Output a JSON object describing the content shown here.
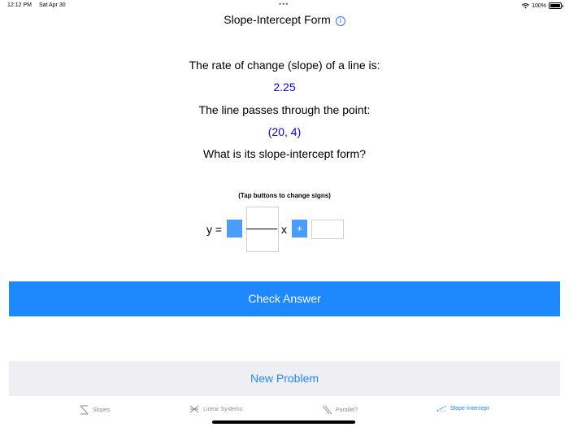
{
  "status": {
    "time": "12:12 PM",
    "date": "Sat Apr 30",
    "center_dots": "•••",
    "battery": "100%"
  },
  "nav": {
    "title": "Slope-Intercept Form",
    "info_icon": "info-icon"
  },
  "question": {
    "line1": "The rate of change (slope) of a line is:",
    "slope": "2.25",
    "line2": "The line passes through the point:",
    "point": "(20, 4)",
    "line3": "What is its slope-intercept form?"
  },
  "hint": "(Tap buttons to change signs)",
  "equation": {
    "y_label": "y =",
    "x_label": "x",
    "plus_sign": "+",
    "numerator": "",
    "denominator": "",
    "intercept": ""
  },
  "buttons": {
    "check": "Check Answer",
    "new": "New Problem"
  },
  "tabs": [
    {
      "label": "Slopes",
      "icon": "slopes-icon",
      "active": false
    },
    {
      "label": "Linear Systems",
      "icon": "linear-systems-icon",
      "active": false
    },
    {
      "label": "Parallel?",
      "icon": "parallel-icon",
      "active": false
    },
    {
      "label": "Slope-Intercept",
      "icon": "slope-intercept-icon",
      "active": true
    }
  ],
  "colors": {
    "accent": "#1e88ff",
    "value_blue": "#0000ee",
    "sign_box": "#4a9cff",
    "secondary_button": "#efeff3"
  }
}
